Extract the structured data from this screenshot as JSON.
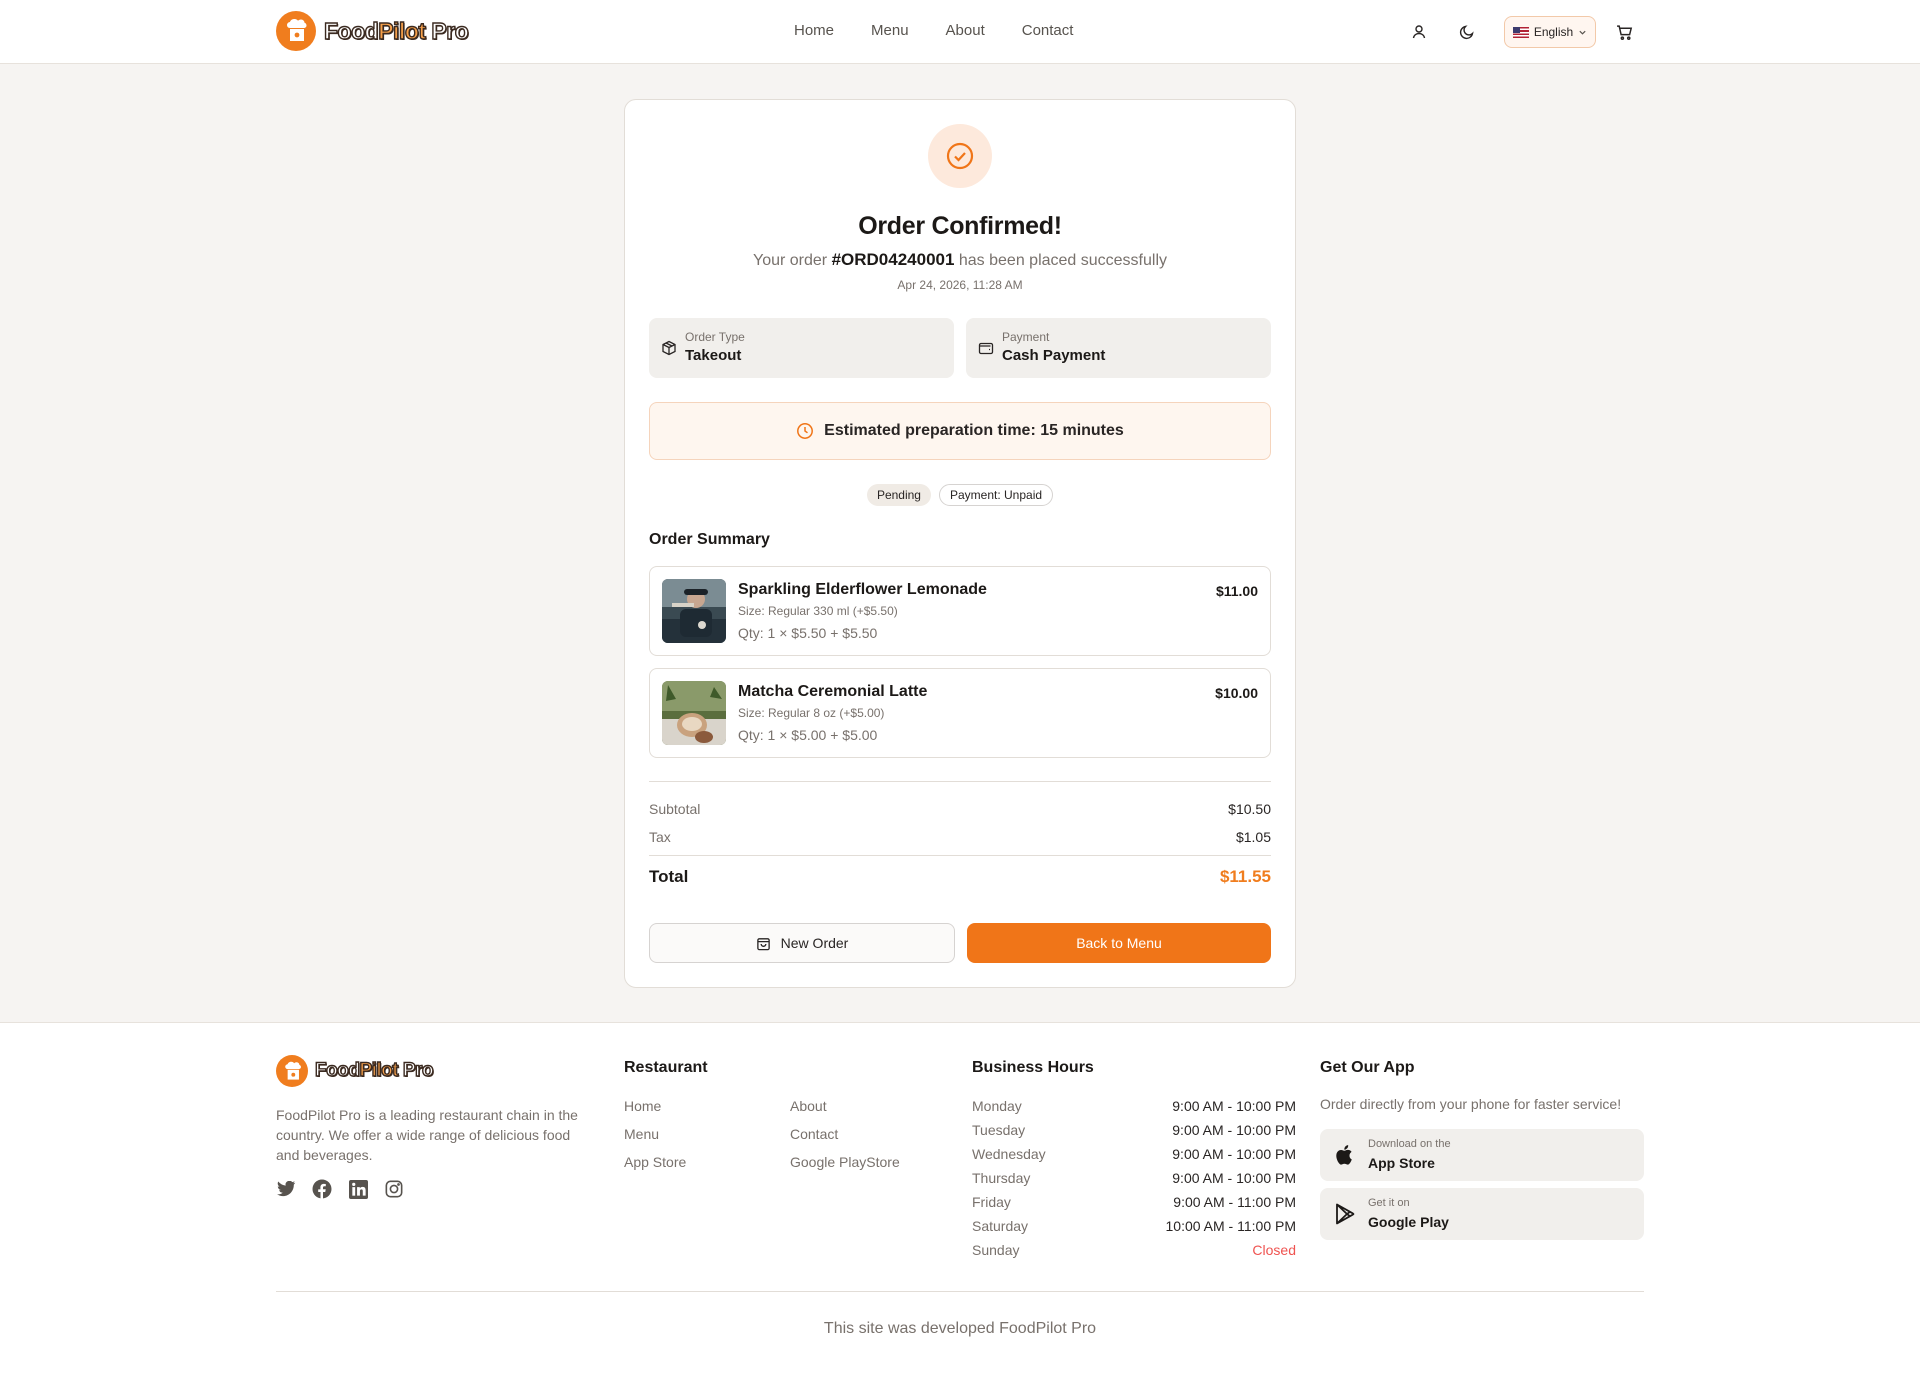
{
  "brand": {
    "name_part1": "Food",
    "name_part2": "Pilot",
    "name_part3": " Pro",
    "accent": "#f07518"
  },
  "nav": {
    "items": [
      "Home",
      "Menu",
      "About",
      "Contact"
    ]
  },
  "header": {
    "language": "English",
    "icons": [
      "user-icon",
      "moon-icon",
      "flag-us-icon",
      "cart-icon"
    ]
  },
  "order": {
    "title": "Order Confirmed!",
    "sub_before": "Your order ",
    "order_id": "#ORD04240001",
    "sub_after": " has been placed successfully",
    "date": "Apr 24, 2026, 11:28 AM",
    "type_label": "Order Type",
    "type_value": "Takeout",
    "payment_label": "Payment",
    "payment_value": "Cash Payment",
    "eta": "Estimated preparation time: 15 minutes",
    "status_badge": "Pending",
    "payment_badge": "Payment: Unpaid",
    "summary_title": "Order Summary",
    "items": [
      {
        "name": "Sparkling Elderflower Lemonade",
        "size": "Size: Regular 330 ml (+$5.50)",
        "qty": "Qty: 1 × $5.50 + $5.50",
        "price": "$11.00"
      },
      {
        "name": "Matcha Ceremonial Latte",
        "size": "Size: Regular 8 oz (+$5.00)",
        "qty": "Qty: 1 × $5.00 + $5.00",
        "price": "$10.00"
      }
    ],
    "subtotal_label": "Subtotal",
    "subtotal_value": "$10.50",
    "tax_label": "Tax",
    "tax_value": "$1.05",
    "total_label": "Total",
    "total_value": "$11.55",
    "new_order_label": "New Order",
    "back_label": "Back to Menu"
  },
  "footer": {
    "about": "FoodPilot Pro is a leading restaurant chain in the country. We offer a wide range of delicious food and beverages.",
    "socials": [
      "twitter-icon",
      "facebook-icon",
      "linkedin-icon",
      "instagram-icon"
    ],
    "restaurant_title": "Restaurant",
    "links_col1": [
      "Home",
      "Menu",
      "App Store"
    ],
    "links_col2": [
      "About",
      "Contact",
      "Google PlayStore"
    ],
    "hours_title": "Business Hours",
    "hours": [
      {
        "day": "Monday",
        "time": "9:00 AM - 10:00 PM"
      },
      {
        "day": "Tuesday",
        "time": "9:00 AM - 10:00 PM"
      },
      {
        "day": "Wednesday",
        "time": "9:00 AM - 10:00 PM"
      },
      {
        "day": "Thursday",
        "time": "9:00 AM - 10:00 PM"
      },
      {
        "day": "Friday",
        "time": "9:00 AM - 11:00 PM"
      },
      {
        "day": "Saturday",
        "time": "10:00 AM - 11:00 PM"
      },
      {
        "day": "Sunday",
        "time": "Closed"
      }
    ],
    "app_title": "Get Our App",
    "app_desc": "Order directly from your phone for faster service!",
    "appstore_line1": "Download on the",
    "appstore_line2": "App Store",
    "play_line1": "Get it on",
    "play_line2": "Google Play",
    "copyright": "This site was developed FoodPilot Pro"
  }
}
